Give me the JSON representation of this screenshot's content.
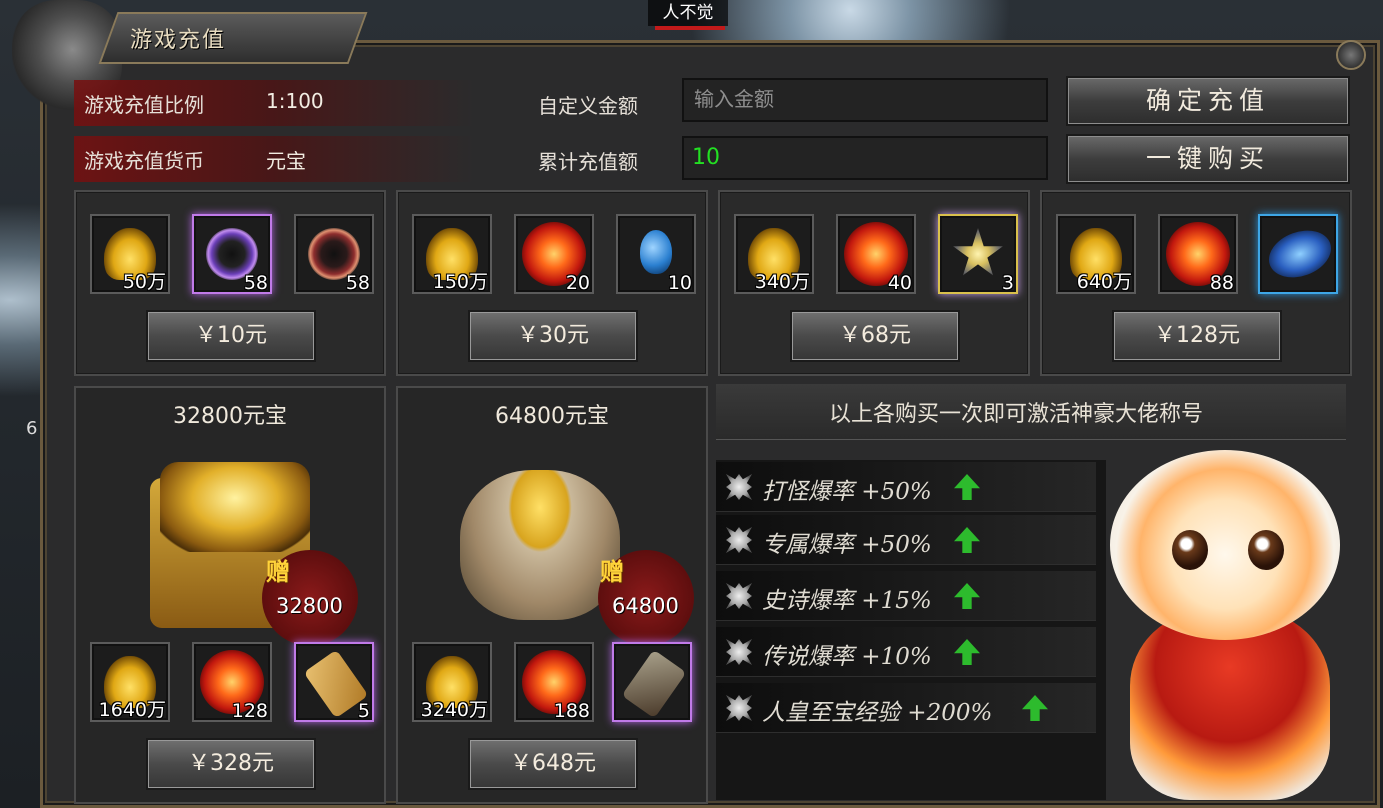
{
  "scene": {
    "name_tag": "人不觉",
    "edge_number": "6"
  },
  "window": {
    "title": "游戏充值"
  },
  "header": {
    "ratio_label": "游戏充值比例",
    "ratio_value": "1:100",
    "currency_label": "游戏充值货币",
    "currency_value": "元宝",
    "custom_amount_label": "自定义金额",
    "custom_amount_placeholder": "输入金额",
    "total_label": "累计充值额",
    "total_value": "10",
    "confirm_button": "确定充值",
    "one_click_button": "一键购买"
  },
  "packs": [
    {
      "items": [
        {
          "icon": "gold-ingot-icon",
          "qty": "50万"
        },
        {
          "icon": "purple-ring-icon",
          "qty": "58"
        },
        {
          "icon": "red-ring-icon",
          "qty": "58"
        }
      ],
      "price": "￥10元"
    },
    {
      "items": [
        {
          "icon": "gold-ingot-icon",
          "qty": "150万"
        },
        {
          "icon": "fire-orb-icon",
          "qty": "20"
        },
        {
          "icon": "blue-potion-icon",
          "qty": "10"
        }
      ],
      "price": "￥30元"
    },
    {
      "items": [
        {
          "icon": "gold-ingot-icon",
          "qty": "340万"
        },
        {
          "icon": "fire-orb-icon",
          "qty": "40"
        },
        {
          "icon": "star-gem-icon",
          "qty": "3"
        }
      ],
      "price": "￥68元"
    },
    {
      "items": [
        {
          "icon": "gold-ingot-icon",
          "qty": "640万"
        },
        {
          "icon": "fire-orb-icon",
          "qty": "88"
        },
        {
          "icon": "blue-fish-icon",
          "qty": ""
        }
      ],
      "price": "￥128元"
    }
  ],
  "big_packs": [
    {
      "title": "32800元宝",
      "bonus_label": "赠",
      "bonus_amount": "32800",
      "items": [
        {
          "icon": "gold-ingot-icon",
          "qty": "1640万"
        },
        {
          "icon": "fire-orb-icon",
          "qty": "128"
        },
        {
          "icon": "gold-scroll-icon",
          "qty": "5"
        }
      ],
      "price": "￥328元"
    },
    {
      "title": "64800元宝",
      "bonus_label": "赠",
      "bonus_amount": "64800",
      "items": [
        {
          "icon": "gold-ingot-icon",
          "qty": "3240万"
        },
        {
          "icon": "fire-orb-icon",
          "qty": "188"
        },
        {
          "icon": "dark-scroll-icon",
          "qty": ""
        }
      ],
      "price": "￥648元"
    }
  ],
  "title_reward": {
    "banner": "以上各购买一次即可激活神豪大佬称号",
    "perks": [
      {
        "text": "打怪爆率 +50%"
      },
      {
        "text": "专属爆率 +50%"
      },
      {
        "text": "史诗爆率 +15%"
      },
      {
        "text": "传说爆率 +10%"
      },
      {
        "text": "人皇至宝经验 +200%"
      }
    ]
  }
}
